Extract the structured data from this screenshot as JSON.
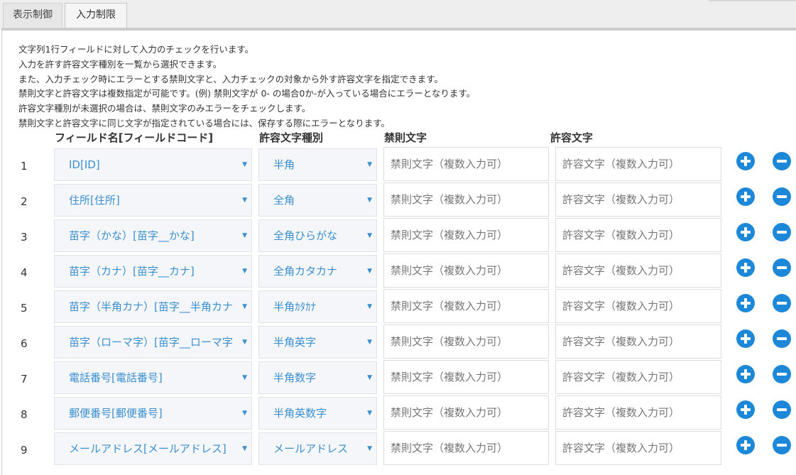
{
  "tabs": [
    {
      "label": "表示制御",
      "active": false
    },
    {
      "label": "入力制限",
      "active": true
    }
  ],
  "description": [
    "文字列1行フィールドに対して入力のチェックを行います。",
    "入力を許す許容文字種別を一覧から選択できます。",
    "また、入力チェック時にエラーとする禁則文字と、入力チェックの対象から外す許容文字を指定できます。",
    "禁則文字と許容文字は複数指定が可能です。(例) 禁則文字が 0- の場合0か-が入っている場合にエラーとなります。",
    "許容文字種別が未選択の場合は、禁則文字のみエラーをチェックします。",
    "禁則文字と許容文字に同じ文字が指定されている場合には、保存する際にエラーとなります。"
  ],
  "columns": {
    "field": "フィールド名[フィールドコード]",
    "type": "許容文字種別",
    "deny": "禁則文字",
    "allow": "許容文字"
  },
  "placeholders": {
    "deny": "禁則文字（複数入力可）",
    "allow": "許容文字（複数入力可）"
  },
  "dropdown_arrow": "▼",
  "colors": {
    "accent": "#1e88d8",
    "select_text": "#3a8fd1"
  },
  "rows": [
    {
      "num": "1",
      "field": "ID[ID]",
      "type": "半角"
    },
    {
      "num": "2",
      "field": "住所[住所]",
      "type": "全角"
    },
    {
      "num": "3",
      "field": "苗字（かな）[苗字__かな]",
      "type": "全角ひらがな"
    },
    {
      "num": "4",
      "field": "苗字（カナ）[苗字__カナ]",
      "type": "全角カタカナ"
    },
    {
      "num": "5",
      "field": "苗字（半角カナ）[苗字__半角カナ]",
      "type": "半角ｶﾀｶﾅ"
    },
    {
      "num": "6",
      "field": "苗字（ローマ字）[苗字__ローマ字]",
      "type": "半角英字"
    },
    {
      "num": "7",
      "field": "電話番号[電話番号]",
      "type": "半角数字"
    },
    {
      "num": "8",
      "field": "郵便番号[郵便番号]",
      "type": "半角英数字"
    },
    {
      "num": "9",
      "field": "メールアドレス[メールアドレス]",
      "type": "メールアドレス"
    }
  ]
}
